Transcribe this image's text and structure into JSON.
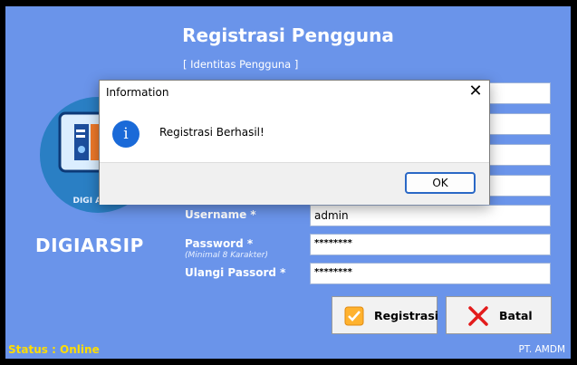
{
  "window": {
    "title": "Registrasi Pengguna",
    "section_title": "[ Identitas Pengguna ]",
    "brand": "DIGIARSIP",
    "logo_caption": "DIGI ARSIP",
    "accent_color": "#6a94ea",
    "status": {
      "text": "Status : Online",
      "company": "PT. AMDM"
    }
  },
  "form": {
    "username": {
      "label": "Username *",
      "value": "admin"
    },
    "password": {
      "label": "Password *",
      "hint": "(Minimal 8 Karakter)",
      "value": "********"
    },
    "confirm": {
      "label": "Ulangi Passord *",
      "value": "********"
    }
  },
  "buttons": {
    "register": {
      "label": "Registrasi",
      "icon": "check-icon"
    },
    "cancel": {
      "label": "Batal",
      "icon": "x-icon"
    }
  },
  "dialog": {
    "title": "Information",
    "message": "Registrasi Berhasil!",
    "ok_label": "OK",
    "close_glyph": "✕",
    "icon_glyph": "i"
  }
}
